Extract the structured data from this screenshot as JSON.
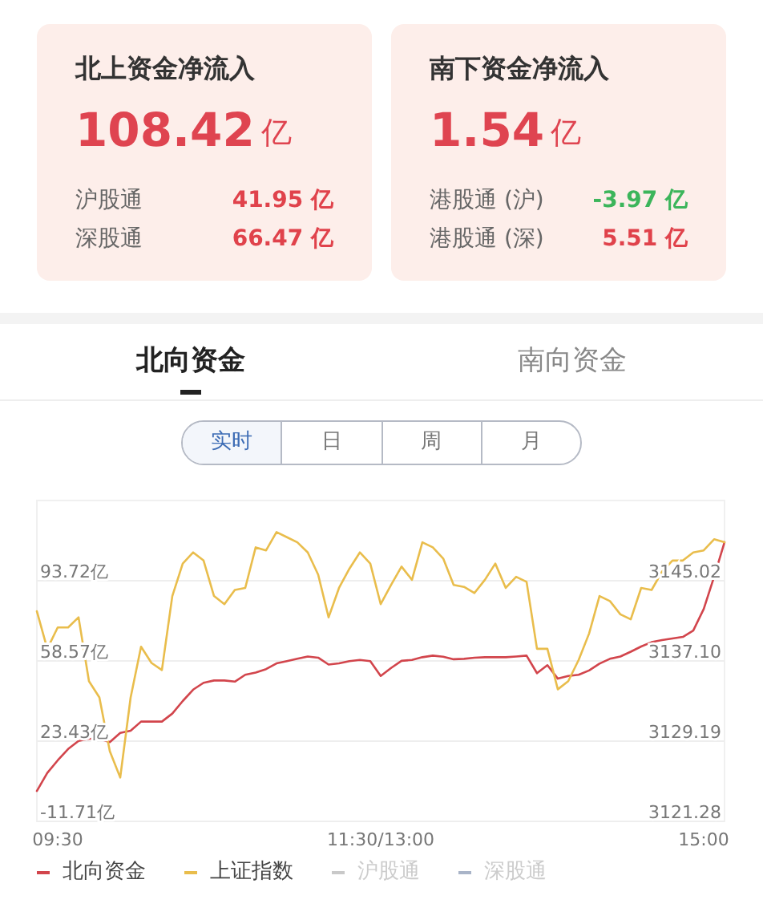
{
  "summary_cards": [
    {
      "title": "北上资金净流入",
      "amount": "108.42",
      "unit": "亿",
      "rows": [
        {
          "label": "沪股通",
          "value": "41.95 亿",
          "color": "#e0424b"
        },
        {
          "label": "深股通",
          "value": "66.47 亿",
          "color": "#e0424b"
        }
      ]
    },
    {
      "title": "南下资金净流入",
      "amount": "1.54",
      "unit": "亿",
      "rows": [
        {
          "label": "港股通 (沪)",
          "value": "-3.97 亿",
          "color": "#3cb55b"
        },
        {
          "label": "港股通 (深)",
          "value": "5.51 亿",
          "color": "#e0424b"
        }
      ]
    }
  ],
  "tabs": [
    {
      "label": "北向资金",
      "selected": true
    },
    {
      "label": "南向资金",
      "selected": false
    }
  ],
  "periods": [
    {
      "label": "实时",
      "selected": true
    },
    {
      "label": "日",
      "selected": false
    },
    {
      "label": "周",
      "selected": false
    },
    {
      "label": "月",
      "selected": false
    }
  ],
  "chart": {
    "chart_data": {
      "type": "line",
      "grid": true,
      "categories": [
        null,
        null,
        "09:30",
        null,
        null,
        null,
        null,
        null,
        null,
        null,
        null,
        null,
        null,
        null,
        null,
        null,
        null,
        null,
        null,
        null,
        null,
        null,
        null,
        null,
        null,
        null,
        null,
        null,
        null,
        null,
        null,
        null,
        null,
        "11:30/13:00",
        null,
        null,
        null,
        null,
        null,
        null,
        null,
        null,
        null,
        null,
        null,
        null,
        null,
        null,
        null,
        null,
        null,
        null,
        null,
        null,
        null,
        null,
        null,
        null,
        null,
        null,
        null,
        null,
        null,
        null,
        "15:00",
        null,
        null
      ],
      "ylim": [
        -11.71,
        128.85
      ],
      "yticks": [
        {
          "value": -11.71,
          "label": "-11.71亿"
        },
        {
          "value": 23.43,
          "label": "23.43亿"
        },
        {
          "value": 58.57,
          "label": "58.57亿"
        },
        {
          "value": 93.72,
          "label": "93.72亿"
        }
      ],
      "y2lim": [
        3121.28,
        3152.92
      ],
      "y2ticks": [
        {
          "value": 3121.28,
          "label": "3121.28"
        },
        {
          "value": 3129.19,
          "label": "3129.19"
        },
        {
          "value": 3137.1,
          "label": "3137.10"
        },
        {
          "value": 3145.02,
          "label": "3145.02"
        }
      ],
      "series": [
        {
          "name": "北向资金",
          "color": "#d2454c",
          "axis": "y",
          "values": [
            1.6,
            9.5,
            15,
            20,
            23.5,
            24.5,
            24.5,
            23,
            27,
            28,
            32,
            32,
            32,
            35.5,
            41,
            46,
            49,
            50,
            50,
            49.5,
            52.5,
            53.5,
            55,
            57.5,
            58.5,
            59.5,
            60.5,
            60,
            57,
            57.5,
            58.5,
            59,
            58.5,
            52,
            55.5,
            58.6,
            59,
            60.2,
            60.9,
            60.4,
            59.3,
            59.5,
            60,
            60.2,
            60.2,
            60.2,
            60.5,
            60.9,
            53.2,
            56.7,
            50.8,
            52,
            52.5,
            54.4,
            57.4,
            59.5,
            60.5,
            62.6,
            64.9,
            66.8,
            67.7,
            68.4,
            69.1,
            71.9,
            81.3,
            95.4,
            110.6
          ]
        },
        {
          "name": "上证指数",
          "color": "#e9bd4c",
          "axis": "y2",
          "values": [
            3142,
            3138.3,
            3140.4,
            3140.4,
            3141.4,
            3135.1,
            3133.5,
            3128.2,
            3125.6,
            3133.5,
            3138.5,
            3136.9,
            3136.2,
            3143.5,
            3146.7,
            3147.8,
            3147,
            3143.5,
            3142.7,
            3144.1,
            3144.3,
            3148.3,
            3148,
            3149.8,
            3149.3,
            3148.8,
            3147.8,
            3145.6,
            3141.4,
            3144.3,
            3146.2,
            3147.8,
            3146.7,
            3142.7,
            3144.6,
            3146.4,
            3145.1,
            3148.8,
            3148.3,
            3147.2,
            3144.6,
            3144.4,
            3143.8,
            3145.1,
            3146.7,
            3144.3,
            3145.4,
            3144.9,
            3138.3,
            3138.3,
            3134.3,
            3135.1,
            3137.2,
            3139.8,
            3143.5,
            3143,
            3141.7,
            3141.2,
            3144.3,
            3144.1,
            3145.9,
            3147,
            3147,
            3147.8,
            3148,
            3149.1,
            3148.8
          ]
        }
      ]
    },
    "legend": [
      {
        "label": "沪股通",
        "color": "#c9c9c9",
        "enabled": false
      },
      {
        "label": "深股通",
        "color": "#a9b4c8",
        "enabled": false
      }
    ]
  }
}
